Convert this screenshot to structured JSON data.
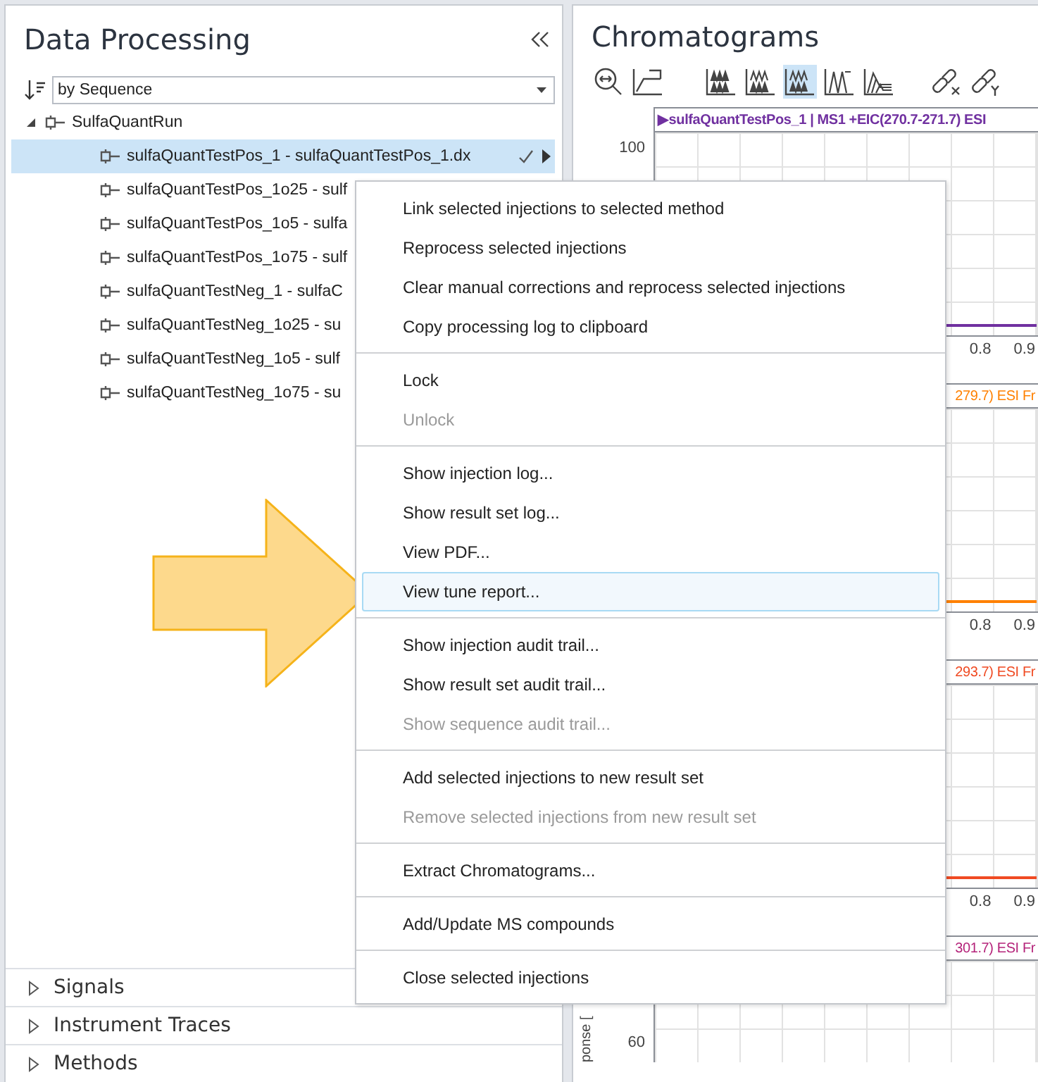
{
  "left_panel": {
    "title": "Data Processing",
    "sort": {
      "value": "by Sequence"
    },
    "tree": [
      {
        "label": "SulfaQuantRun",
        "expanded": true,
        "children": [
          {
            "label": "sulfaQuantTestPos_1 - sulfaQuantTestPos_1.dx",
            "selected": true
          },
          {
            "label": "sulfaQuantTestPos_1o25 - sulf",
            "selected": false
          },
          {
            "label": "sulfaQuantTestPos_1o5 - sulfa",
            "selected": false
          },
          {
            "label": "sulfaQuantTestPos_1o75 - sulf",
            "selected": false
          },
          {
            "label": "sulfaQuantTestNeg_1 - sulfaC",
            "selected": false
          },
          {
            "label": "sulfaQuantTestNeg_1o25 - su",
            "selected": false
          },
          {
            "label": "sulfaQuantTestNeg_1o5 - sulf",
            "selected": false
          },
          {
            "label": "sulfaQuantTestNeg_1o75 - su",
            "selected": false
          }
        ]
      }
    ],
    "sections": [
      {
        "label": "Signals",
        "expanded": false
      },
      {
        "label": "Instrument Traces",
        "expanded": false
      },
      {
        "label": "Methods",
        "expanded": false
      }
    ]
  },
  "chromatograms": {
    "title": "Chromatograms",
    "layout_buttons": [
      {
        "selected": false
      },
      {
        "selected": false
      },
      {
        "selected": true
      },
      {
        "selected": false
      },
      {
        "selected": false
      }
    ],
    "plots": [
      {
        "header": "▶sulfaQuantTestPos_1 | MS1 +EIC(270.7-271.7) ESI",
        "color": "#7030a0",
        "trace_visible": true,
        "y_tick": "100",
        "x_ticks": [
          "0.8",
          "0.9"
        ]
      },
      {
        "header": "279.7) ESI Fr",
        "color": "#ff8000",
        "trace_visible": true,
        "x_ticks": [
          "0.8",
          "0.9"
        ]
      },
      {
        "header": "293.7) ESI Fr",
        "color": "#f04a22",
        "trace_visible": true,
        "x_ticks": [
          "0.8",
          "0.9"
        ]
      },
      {
        "header": "301.7) ESI Fr",
        "color": "#b4237a",
        "trace_visible": false,
        "y_tick": "60",
        "y_label": "ponse ["
      }
    ]
  },
  "context_menu": {
    "groups": [
      [
        {
          "label": "Link selected injections to selected method",
          "disabled": false,
          "highlighted": false
        },
        {
          "label": "Reprocess selected injections",
          "disabled": false,
          "highlighted": false
        },
        {
          "label": "Clear manual corrections and reprocess selected injections",
          "disabled": false,
          "highlighted": false
        },
        {
          "label": "Copy processing log to clipboard",
          "disabled": false,
          "highlighted": false
        }
      ],
      [
        {
          "label": "Lock",
          "disabled": false,
          "highlighted": false
        },
        {
          "label": "Unlock",
          "disabled": true,
          "highlighted": false
        }
      ],
      [
        {
          "label": "Show injection log...",
          "disabled": false,
          "highlighted": false
        },
        {
          "label": "Show result set log...",
          "disabled": false,
          "highlighted": false
        },
        {
          "label": "View PDF...",
          "disabled": false,
          "highlighted": false
        },
        {
          "label": "View tune report...",
          "disabled": false,
          "highlighted": true
        }
      ],
      [
        {
          "label": "Show injection audit trail...",
          "disabled": false,
          "highlighted": false
        },
        {
          "label": "Show result set audit trail...",
          "disabled": false,
          "highlighted": false
        },
        {
          "label": "Show sequence audit trail...",
          "disabled": true,
          "highlighted": false
        }
      ],
      [
        {
          "label": "Add selected injections to new result set",
          "disabled": false,
          "highlighted": false
        },
        {
          "label": "Remove selected injections from new result set",
          "disabled": true,
          "highlighted": false
        }
      ],
      [
        {
          "label": "Extract Chromatograms...",
          "disabled": false,
          "highlighted": false
        }
      ],
      [
        {
          "label": "Add/Update MS compounds",
          "disabled": false,
          "highlighted": false
        }
      ],
      [
        {
          "label": "Close selected injections",
          "disabled": false,
          "highlighted": false
        }
      ]
    ]
  }
}
